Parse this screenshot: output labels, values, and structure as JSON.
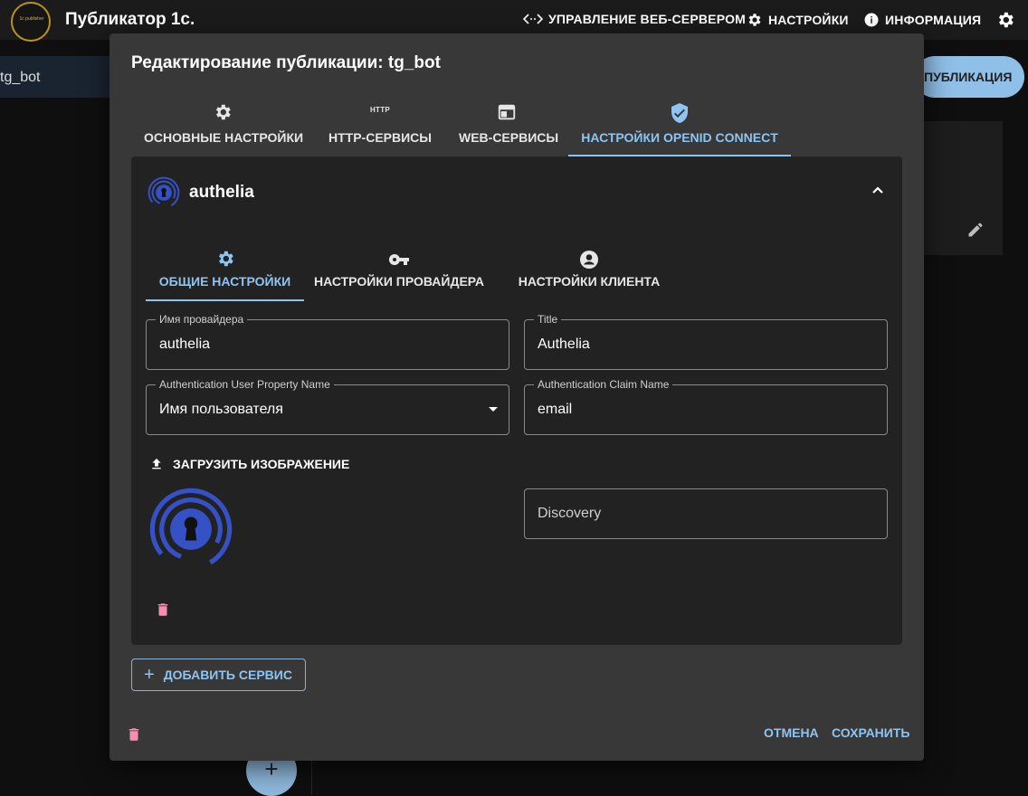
{
  "app": {
    "title": "Публикатор 1с.",
    "logo_text": "1c publisher",
    "nav": {
      "web_server": "УПРАВЛЕНИЕ ВЕБ-СЕРВЕРОМ",
      "settings": "НАСТРОЙКИ",
      "info": "ИНФОРМАЦИЯ"
    },
    "sidebar_item": "tg_bot",
    "publication_button": "ПУБЛИКАЦИЯ",
    "fab": "+"
  },
  "dialog": {
    "title": "Редактирование публикации: tg_bot",
    "tabs": [
      {
        "label": "ОСНОВНЫЕ НАСТРОЙКИ",
        "icon": "gear-icon"
      },
      {
        "label": "HTTP-СЕРВИСЫ",
        "icon": "http-icon",
        "icon_text": "HTTP"
      },
      {
        "label": "WEB-СЕРВИСЫ",
        "icon": "web-icon"
      },
      {
        "label": "НАСТРОЙКИ OPENID CONNECT",
        "icon": "verified-shield-icon",
        "active": true
      }
    ],
    "provider": {
      "name": "authelia",
      "subtabs": [
        {
          "label": "ОБЩИЕ НАСТРОЙКИ",
          "icon": "gear-icon",
          "active": true
        },
        {
          "label": "НАСТРОЙКИ ПРОВАЙДЕРА",
          "icon": "key-icon"
        },
        {
          "label": "НАСТРОЙКИ КЛИЕНТА",
          "icon": "account-icon"
        }
      ],
      "fields": {
        "provider_name": {
          "label": "Имя провайдера",
          "value": "authelia"
        },
        "title": {
          "label": "Title",
          "value": "Authelia"
        },
        "user_property": {
          "label": "Authentication User Property Name",
          "value": "Имя пользователя"
        },
        "claim_name": {
          "label": "Authentication Claim Name",
          "value": "email"
        },
        "discovery": {
          "placeholder": "Discovery"
        }
      },
      "upload_label": "ЗАГРУЗИТЬ ИЗОБРАЖЕНИЕ"
    },
    "add_service_label": "ДОБАВИТЬ СЕРВИС",
    "cancel_label": "ОТМЕНА",
    "save_label": "СОХРАНИТЬ"
  },
  "colors": {
    "accent": "#8ec4f0",
    "danger": "#f48fb1",
    "dialog_bg": "#383838",
    "panel_bg": "#222222"
  }
}
